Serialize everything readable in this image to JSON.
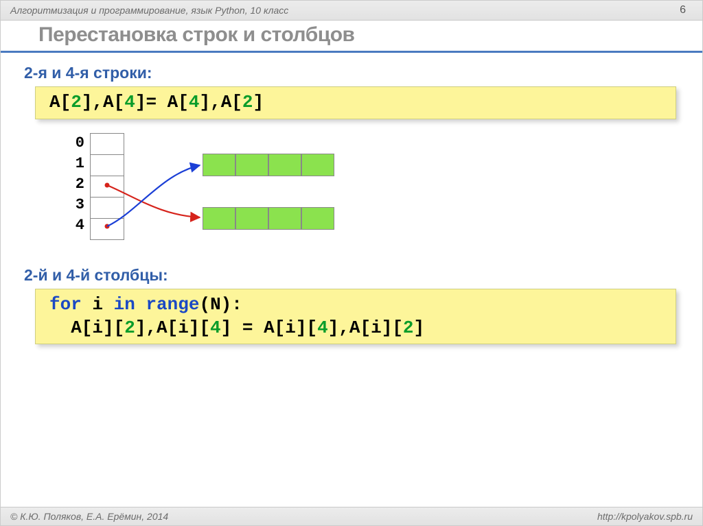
{
  "header": {
    "course": "Алгоритмизация и программирование, язык Python, 10 класс",
    "page": "6"
  },
  "title": "Перестановка строк и столбцов",
  "section1": {
    "heading": "2-я и 4-я строки:",
    "code": {
      "t0": "A[",
      "n0": "2",
      "t1": "],A[",
      "n1": "4",
      "t2": "]= A[",
      "n2": "4",
      "t3": "],A[",
      "n3": "2",
      "t4": "]"
    }
  },
  "diagram": {
    "rows": [
      "0",
      "1",
      "2",
      "3",
      "4"
    ]
  },
  "section2": {
    "heading": "2-й и 4-й столбцы:",
    "code": {
      "l1_kw1": "for",
      "l1_t1": " i ",
      "l1_kw2": "in",
      "l1_t2": " ",
      "l1_kw3": "range",
      "l1_t3": "(N):",
      "l2_t0": "  A[i][",
      "l2_n0": "2",
      "l2_t1": "],A[i][",
      "l2_n1": "4",
      "l2_t2": "] = A[i][",
      "l2_n2": "4",
      "l2_t3": "],A[i][",
      "l2_n3": "2",
      "l2_t4": "]"
    }
  },
  "footer": {
    "authors": "© К.Ю. Поляков, Е.А. Ерёмин, 2014",
    "url": "http://kpolyakov.spb.ru"
  }
}
